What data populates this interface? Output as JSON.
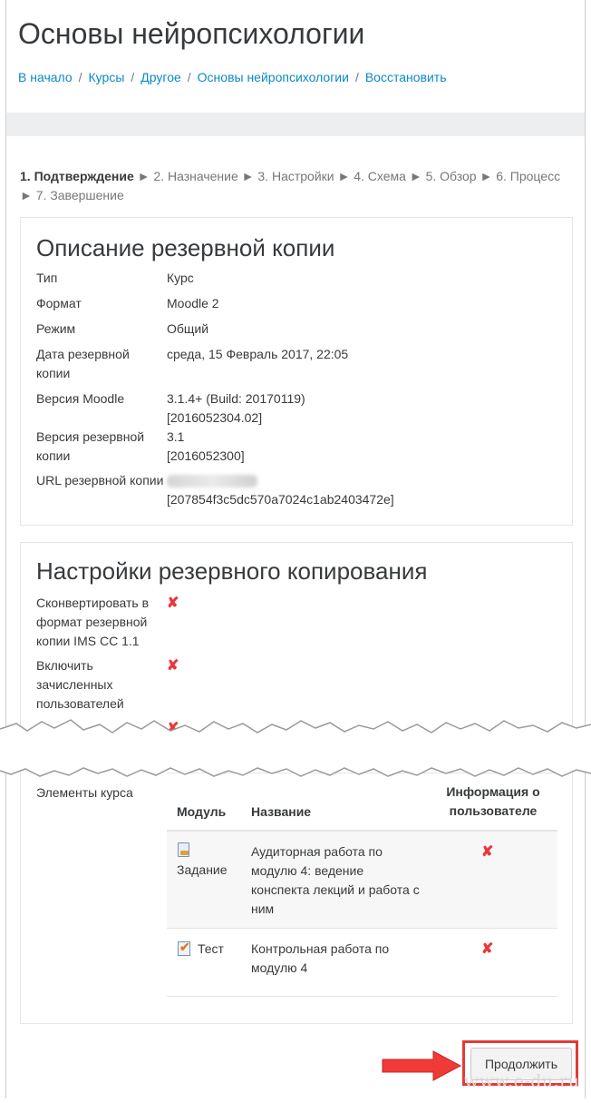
{
  "page_title": "Основы нейропсихологии",
  "breadcrumb": [
    "В начало",
    "Курсы",
    "Другое",
    "Основы нейропсихологии",
    "Восстановить"
  ],
  "steps": {
    "current": "1. Подтверждение",
    "rest_line1": "2. Назначение ► 3. Настройки ► 4. Схема ► 5. Обзор ► 6. Процесс",
    "rest_line2": "7. Завершение"
  },
  "backup_description": {
    "heading": "Описание резервной копии",
    "rows": [
      {
        "label": "Тип",
        "value": "Курс"
      },
      {
        "label": "Формат",
        "value": "Moodle 2"
      },
      {
        "label": "Режим",
        "value": "Общий"
      },
      {
        "label": "Дата резервной копии",
        "value": "среда, 15 Февраль 2017, 22:05"
      },
      {
        "label": "Версия Moodle",
        "value": "3.1.4+ (Build: 20170119)",
        "value2": "[2016052304.02]"
      },
      {
        "label": "Версия резервной копии",
        "value": "3.1",
        "value2": "[2016052300]"
      },
      {
        "label": "URL резервной копии",
        "value2": "[207854f3c5dc570a7024c1ab2403472e]"
      }
    ]
  },
  "backup_settings": {
    "heading": "Настройки резервного копирования",
    "rows": [
      {
        "label": "Сконвертировать в формат резервной копии IMS CC 1.1"
      },
      {
        "label": "Включить зачисленных пользователей"
      }
    ]
  },
  "course_elements": {
    "label": "Элементы курса",
    "headers": {
      "module": "Модуль",
      "name": "Название",
      "userinfo": "Информация о пользователе"
    },
    "rows": [
      {
        "module": "Задание",
        "name": "Аудиторная работа по модулю 4: ведение конспекта лекций и работа с ним",
        "icon": "assignment-icon"
      },
      {
        "module": "Тест",
        "name": "Контрольная работа по модулю 4",
        "icon": "quiz-icon"
      }
    ]
  },
  "continue_label": "Продолжить",
  "watermark": "www.e-du.ru",
  "colors": {
    "link": "#0a8ac4",
    "cross": "#e8373a",
    "highlight": "#e53935"
  }
}
